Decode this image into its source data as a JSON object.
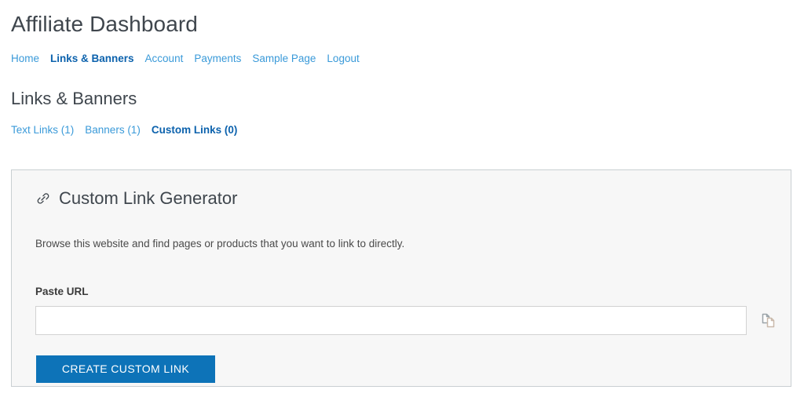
{
  "header": {
    "title": "Affiliate Dashboard"
  },
  "main_nav": {
    "items": [
      {
        "label": "Home",
        "active": false,
        "name": "nav-item-home"
      },
      {
        "label": "Links & Banners",
        "active": true,
        "name": "nav-item-links-banners"
      },
      {
        "label": "Account",
        "active": false,
        "name": "nav-item-account"
      },
      {
        "label": "Payments",
        "active": false,
        "name": "nav-item-payments"
      },
      {
        "label": "Sample Page",
        "active": false,
        "name": "nav-item-sample-page"
      },
      {
        "label": "Logout",
        "active": false,
        "name": "nav-item-logout"
      }
    ]
  },
  "section": {
    "title": "Links & Banners"
  },
  "sub_tabs": {
    "items": [
      {
        "label": "Text Links (1)",
        "active": false,
        "name": "tab-text-links"
      },
      {
        "label": "Banners (1)",
        "active": false,
        "name": "tab-banners"
      },
      {
        "label": "Custom Links (0)",
        "active": true,
        "name": "tab-custom-links"
      }
    ]
  },
  "card": {
    "icon": "link-icon",
    "title": "Custom Link Generator",
    "description": "Browse this website and find pages or products that you want to link to directly.",
    "field_label": "Paste URL",
    "input_value": "",
    "input_placeholder": "",
    "copy_icon": "copy-icon",
    "submit_label": "CREATE CUSTOM LINK"
  },
  "colors": {
    "link": "#3a9ad9",
    "link_active": "#0c62ad",
    "button": "#0d73b8",
    "heading": "#3f464d",
    "card_bg": "#f7f7f7",
    "card_border": "#c9cfd2"
  }
}
